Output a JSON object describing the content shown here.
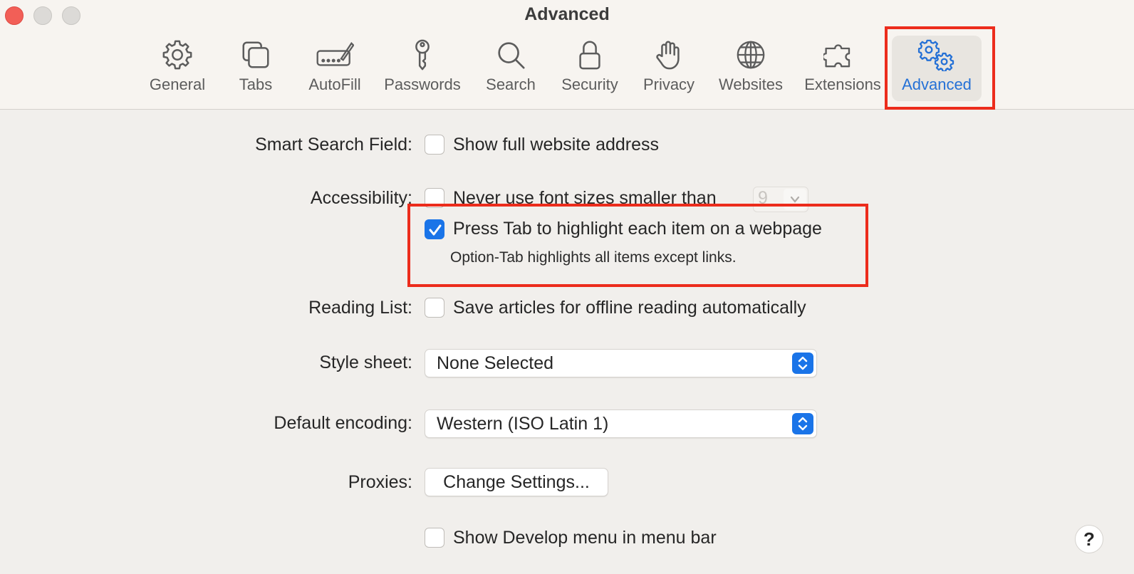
{
  "window": {
    "title": "Advanced"
  },
  "toolbar": {
    "items": [
      {
        "label": "General",
        "icon": "gear-icon"
      },
      {
        "label": "Tabs",
        "icon": "tabs-icon"
      },
      {
        "label": "AutoFill",
        "icon": "autofill-icon"
      },
      {
        "label": "Passwords",
        "icon": "key-icon"
      },
      {
        "label": "Search",
        "icon": "search-icon"
      },
      {
        "label": "Security",
        "icon": "lock-icon"
      },
      {
        "label": "Privacy",
        "icon": "hand-icon"
      },
      {
        "label": "Websites",
        "icon": "globe-icon"
      },
      {
        "label": "Extensions",
        "icon": "puzzle-icon"
      },
      {
        "label": "Advanced",
        "icon": "gears-icon",
        "selected": true
      }
    ]
  },
  "settings": {
    "smart_search": {
      "label": "Smart Search Field:",
      "option": "Show full website address",
      "checked": false
    },
    "accessibility": {
      "label": "Accessibility:",
      "font_option": "Never use font sizes smaller than",
      "font_checked": false,
      "font_size": "9",
      "tab_option": "Press Tab to highlight each item on a webpage",
      "tab_checked": true,
      "tab_note": "Option-Tab highlights all items except links."
    },
    "reading_list": {
      "label": "Reading List:",
      "option": "Save articles for offline reading automatically",
      "checked": false
    },
    "style_sheet": {
      "label": "Style sheet:",
      "value": "None Selected"
    },
    "encoding": {
      "label": "Default encoding:",
      "value": "Western (ISO Latin 1)"
    },
    "proxies": {
      "label": "Proxies:",
      "button": "Change Settings..."
    },
    "develop": {
      "option": "Show Develop menu in menu bar",
      "checked": false
    }
  },
  "help": {
    "label": "?"
  },
  "colors": {
    "accent": "#1a74e8",
    "highlight": "#ec2c1c",
    "selected_text": "#2571d6"
  }
}
